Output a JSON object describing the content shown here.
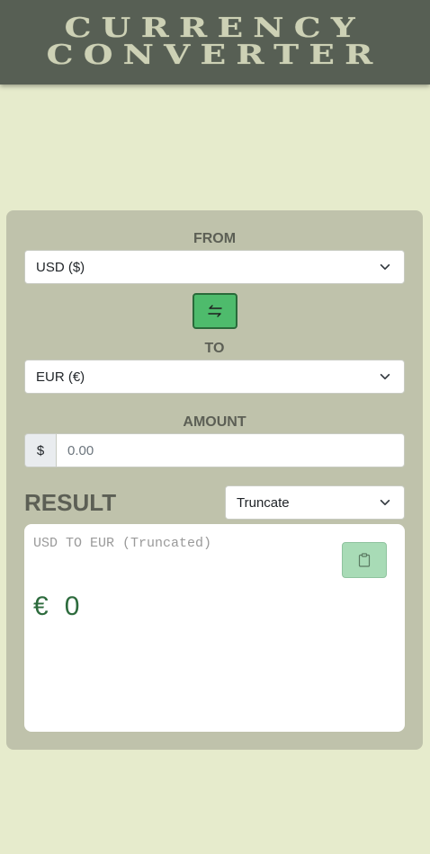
{
  "header": {
    "title_line1": "CURRENCY",
    "title_line2": "CONVERTER"
  },
  "converter": {
    "from_label": "FROM",
    "from_value": "USD ($)",
    "to_label": "TO",
    "to_value": "EUR (€)",
    "amount_label": "AMOUNT",
    "amount_prefix": "$",
    "amount_placeholder": "0.00",
    "swap_icon": "swap-arrows-icon"
  },
  "result": {
    "title": "RESULT",
    "mode_value": "Truncate",
    "caption": "USD TO EUR (Truncated)",
    "currency_symbol": "€",
    "value": "0",
    "copy_icon": "clipboard-icon"
  },
  "colors": {
    "background": "#e6ebcc",
    "header": "#575f54",
    "panel": "#bfc2ab",
    "swap_button": "#4ebb6c",
    "result_text": "#2d6b3d"
  }
}
